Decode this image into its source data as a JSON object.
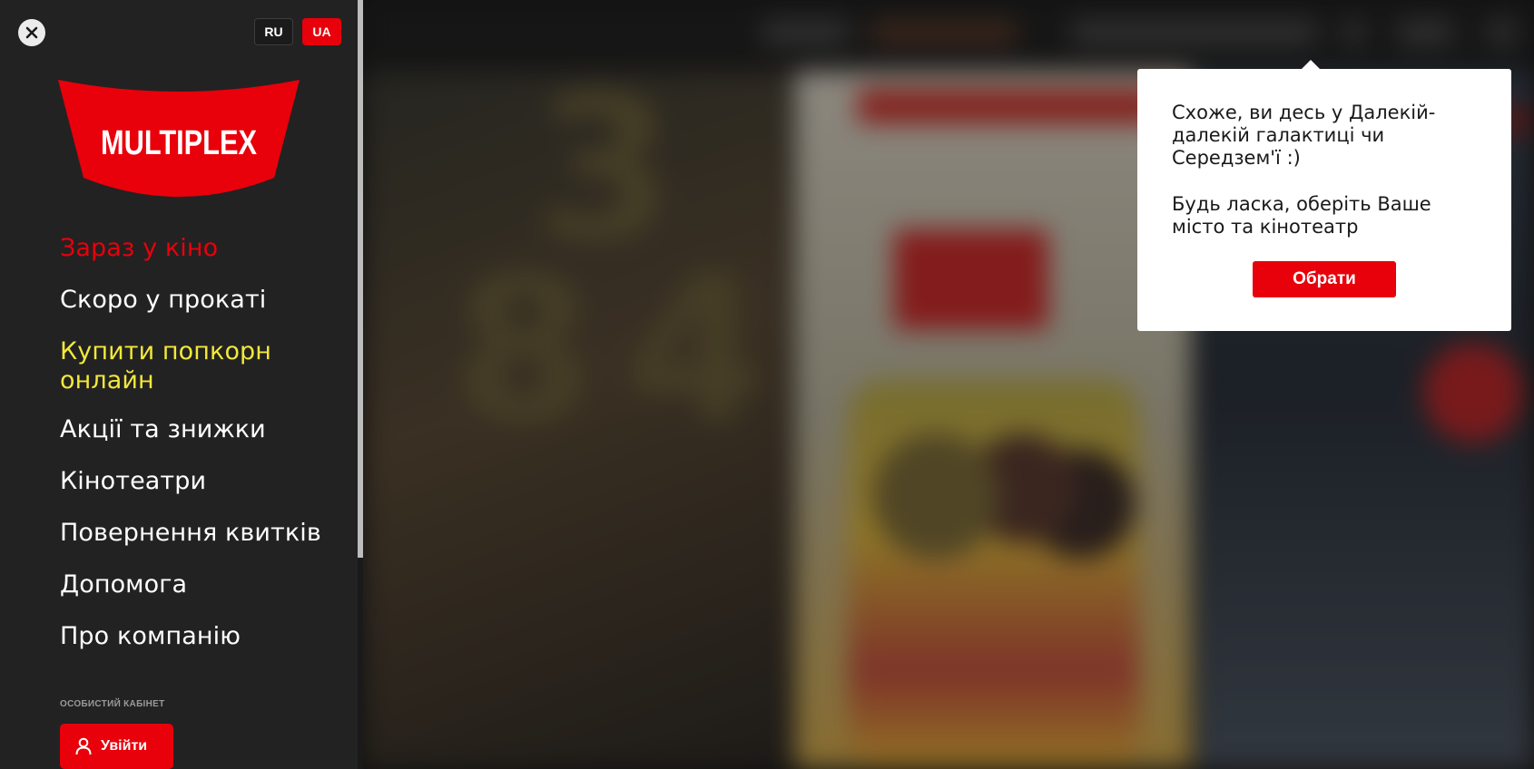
{
  "languages": {
    "ru": "RU",
    "ua": "UA",
    "active": "UA"
  },
  "brand": {
    "logo_text": "MULTIPLEX",
    "color": "#e8000b"
  },
  "nav": {
    "items": [
      {
        "label": "Зараз у кіно",
        "state": "active"
      },
      {
        "label": "Скоро у прокаті"
      },
      {
        "label": "Купити попкорн онлайн",
        "state": "highlight"
      },
      {
        "label": "Акції та знижки"
      },
      {
        "label": "Кінотеатри"
      },
      {
        "label": "Повернення квитків"
      },
      {
        "label": "Допомога"
      },
      {
        "label": "Про компанію"
      }
    ]
  },
  "cabinet": {
    "label": "ОСОБИСТИЙ КАБІНЕТ",
    "login_label": "Увійти"
  },
  "popover": {
    "message_1": "Схоже, ви десь у Далекій-далекій галактиці чи Середзем'ї :)",
    "message_2": "Будь ласка, оберіть Ваше місто та кінотеатр",
    "button_label": "Обрати"
  },
  "icons": {
    "close": "close-icon",
    "user": "user-icon"
  },
  "colors": {
    "sidebar_bg": "#222222",
    "accent": "#e8000b",
    "highlight": "#f2e83a"
  }
}
